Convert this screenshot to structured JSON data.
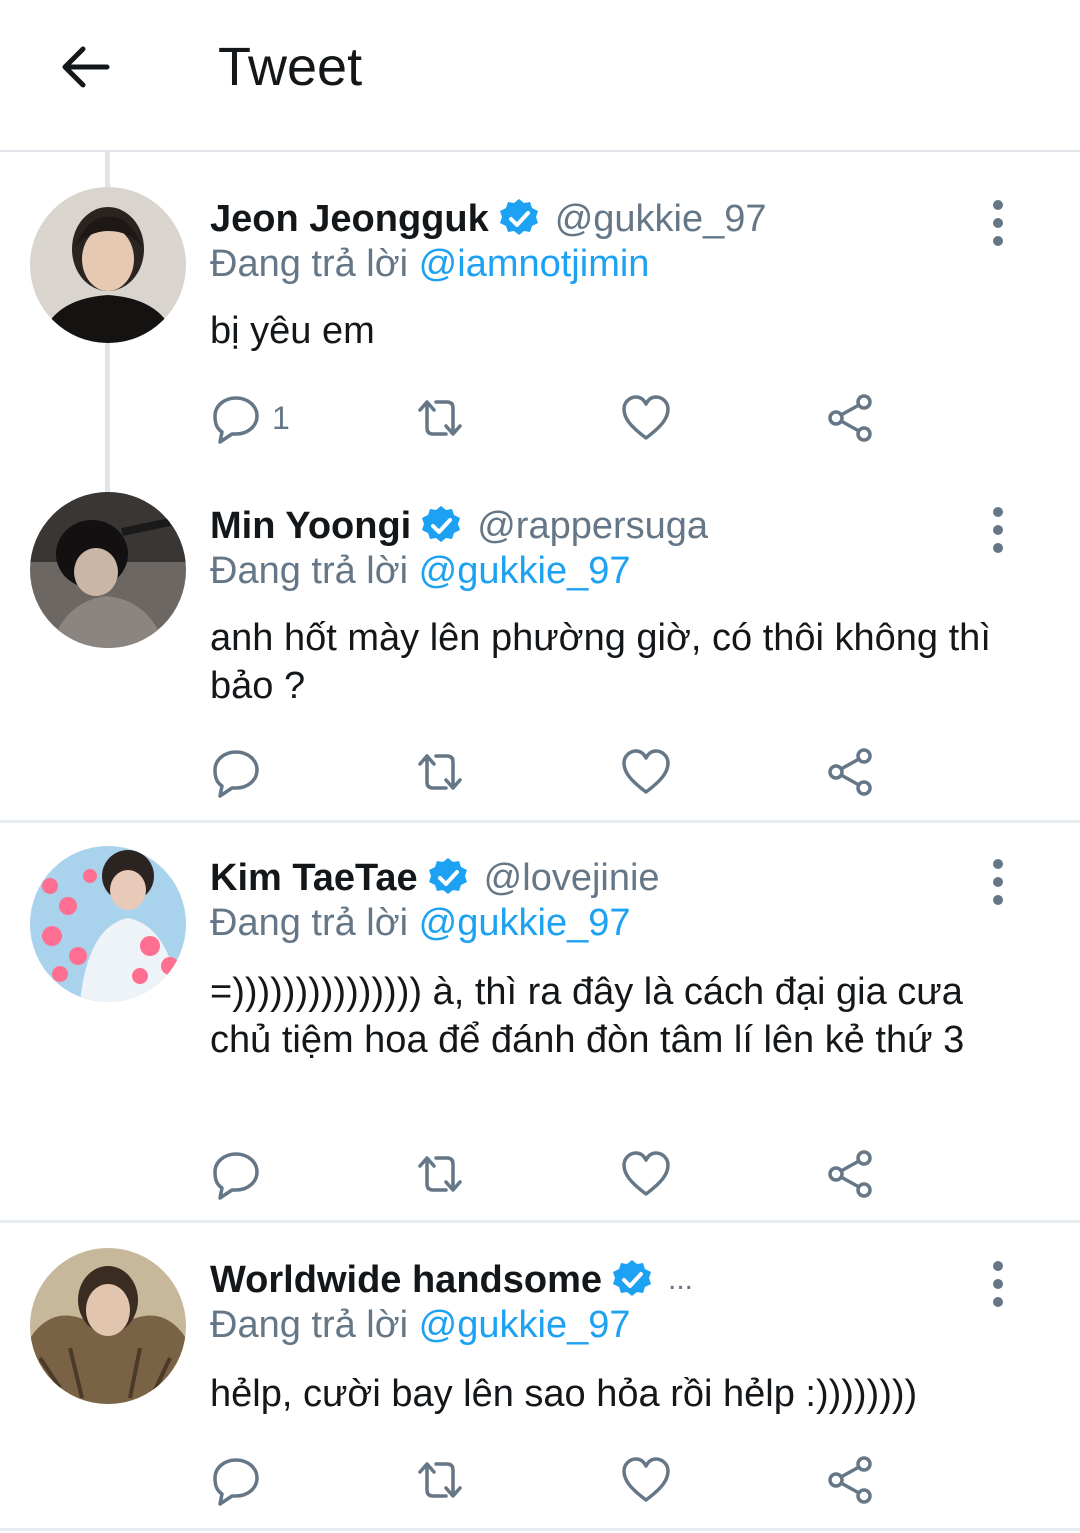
{
  "header": {
    "title": "Tweet"
  },
  "tweets": [
    {
      "name": "Jeon Jeongguk",
      "handle": "@gukkie_97",
      "reply_prefix": "Đang trả lời",
      "reply_to": "@iamnotjimin",
      "text": "bị yêu em",
      "reply_count": "1"
    },
    {
      "name": "Min Yoongi",
      "handle": "@rappersuga",
      "reply_prefix": "Đang trả lời",
      "reply_to": "@gukkie_97",
      "text": "anh hốt mày lên phường giờ, có thôi không thì bảo ?",
      "reply_count": ""
    },
    {
      "name": "Kim TaeTae",
      "handle": "@lovejinie",
      "reply_prefix": "Đang trả lời",
      "reply_to": "@gukkie_97",
      "text": "=))))))))))))))) à, thì ra đây là cách đại gia cưa chủ tiệm hoa để đánh đòn tâm lí lên kẻ thứ 3",
      "reply_count": ""
    },
    {
      "name": "Worldwide handsome",
      "handle": "...",
      "reply_prefix": "Đang trả lời",
      "reply_to": "@gukkie_97",
      "text": "hẻlp, cười bay lên sao hỏa rồi hẻlp :))))))))",
      "reply_count": ""
    }
  ],
  "icons": {
    "back": "arrow-left-icon",
    "verified": "verified-badge-icon",
    "more": "more-vertical-icon",
    "reply": "reply-icon",
    "retweet": "retweet-icon",
    "like": "heart-icon",
    "share": "share-icon"
  },
  "colors": {
    "accent": "#1da1f2",
    "text": "#14171a",
    "secondary": "#657786",
    "divider": "#e6ecf0"
  }
}
